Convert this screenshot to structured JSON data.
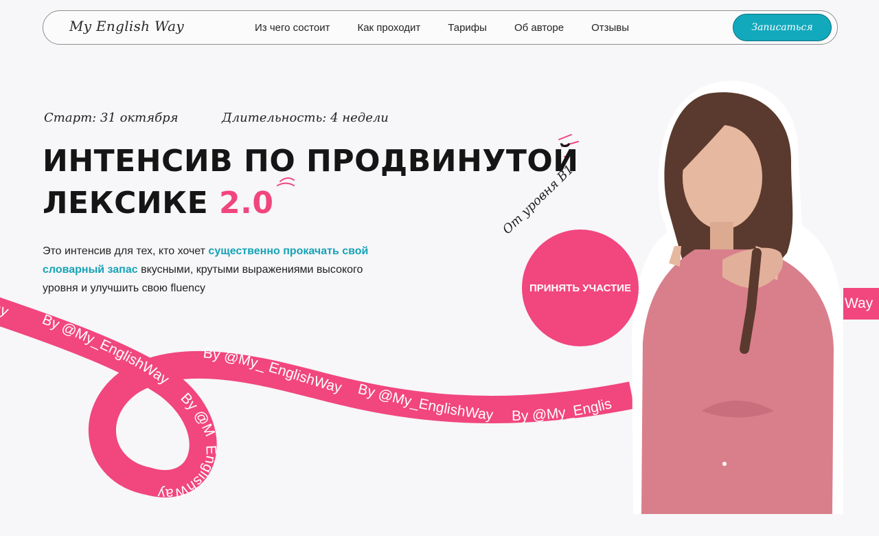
{
  "header": {
    "logo": "My English Way",
    "nav": [
      "Из чего состоит",
      "Как проходит",
      "Тарифы",
      "Об авторе",
      "Отзывы"
    ],
    "cta": "Записаться"
  },
  "hero": {
    "start": "Старт: 31 октября",
    "duration": "Длительность: 4 недели",
    "title_line1": "ИНТЕНСИВ ПО ПРОДВИНУТОЙ",
    "title_line2": "ЛЕКСИКЕ",
    "title_accent": "2.0",
    "desc_part1": "Это интенсив для тех, кто хочет ",
    "desc_highlight": "существенно прокачать свой словарный запас",
    "desc_part2": " вкусными, крутыми выражениями высокого уровня и улучшить свою fluency",
    "level": "От уровня В1",
    "participate": "ПРИНЯТЬ УЧАСТИЕ"
  },
  "ribbon": {
    "fragments": [
      "Way",
      "By @My_EnglishWay",
      "By @My_ EnglishWay",
      "By @My_EnglishWay",
      "By @My_Englis",
      "By @My_",
      "EnglishWay",
      "Way"
    ]
  },
  "colors": {
    "accent_pink": "#f0467d",
    "accent_teal": "#12a9bd",
    "background": "#f7f6f8"
  },
  "icons": {
    "decor_strokes": "pink-accent-strokes"
  }
}
